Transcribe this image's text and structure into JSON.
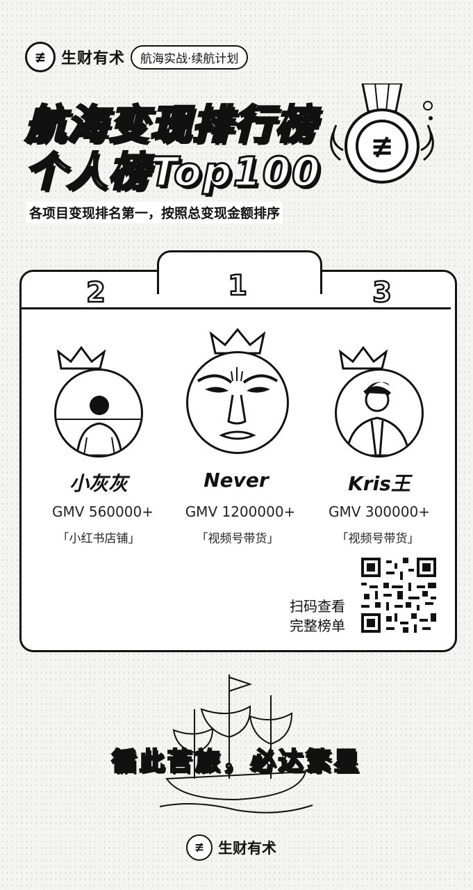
{
  "header": {
    "brand": "生财有术",
    "plan": "航海实战·续航计划",
    "logo_glyph": "≢",
    "title_line1": "航海变现排行榜",
    "title_line2": "个人榜Top100",
    "subtitle": "各项目变现排名第一，按照总变现金额排序"
  },
  "leaderboard": {
    "entries": [
      {
        "rank": "2",
        "name": "小灰灰",
        "gmv": "GMV 560000+",
        "category": "「小红书店铺」"
      },
      {
        "rank": "1",
        "name": "Never",
        "gmv": "GMV 1200000+",
        "category": "「视频号带货」"
      },
      {
        "rank": "3",
        "name": "Kris王",
        "gmv": "GMV 300000+",
        "category": "「视频号带货」"
      }
    ],
    "qr_line1": "扫码查看",
    "qr_line2": "完整榜单"
  },
  "footer": {
    "slogan": "循此苦旅，必达繁星",
    "brand": "生财有术",
    "logo_glyph": "≢"
  },
  "colors": {
    "ink": "#111111",
    "paper": "#f4f4f2"
  }
}
